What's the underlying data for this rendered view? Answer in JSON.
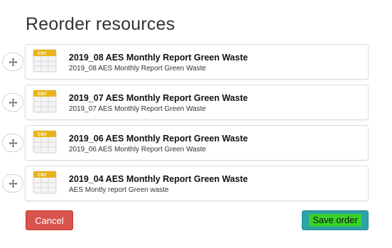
{
  "title": "Reorder resources",
  "colors": {
    "cancel": "#d9534f",
    "save": "#2ea2aa",
    "save_highlight": "#39d12b",
    "csv_icon": "#e8b418"
  },
  "resources": [
    {
      "icon": "csv-file-icon",
      "icon_label": "CSV",
      "title": "2019_08 AES Monthly Report Green Waste",
      "description": "2019_08 AES Monthly Report Green Waste"
    },
    {
      "icon": "csv-file-icon",
      "icon_label": "CSV",
      "title": "2019_07 AES Monthly Report Green Waste",
      "description": "2019_07 AES Monthly Report Green Waste"
    },
    {
      "icon": "csv-file-icon",
      "icon_label": "CSV",
      "title": "2019_06 AES Monthly Report Green Waste",
      "description": "2019_06 AES Monthly Report Green Waste"
    },
    {
      "icon": "csv-file-icon",
      "icon_label": "CSV",
      "title": "2019_04 AES Monthly Report Green Waste",
      "description": "AES Montly report Green waste"
    }
  ],
  "actions": {
    "cancel_label": "Cancel",
    "save_label": "Save order"
  }
}
